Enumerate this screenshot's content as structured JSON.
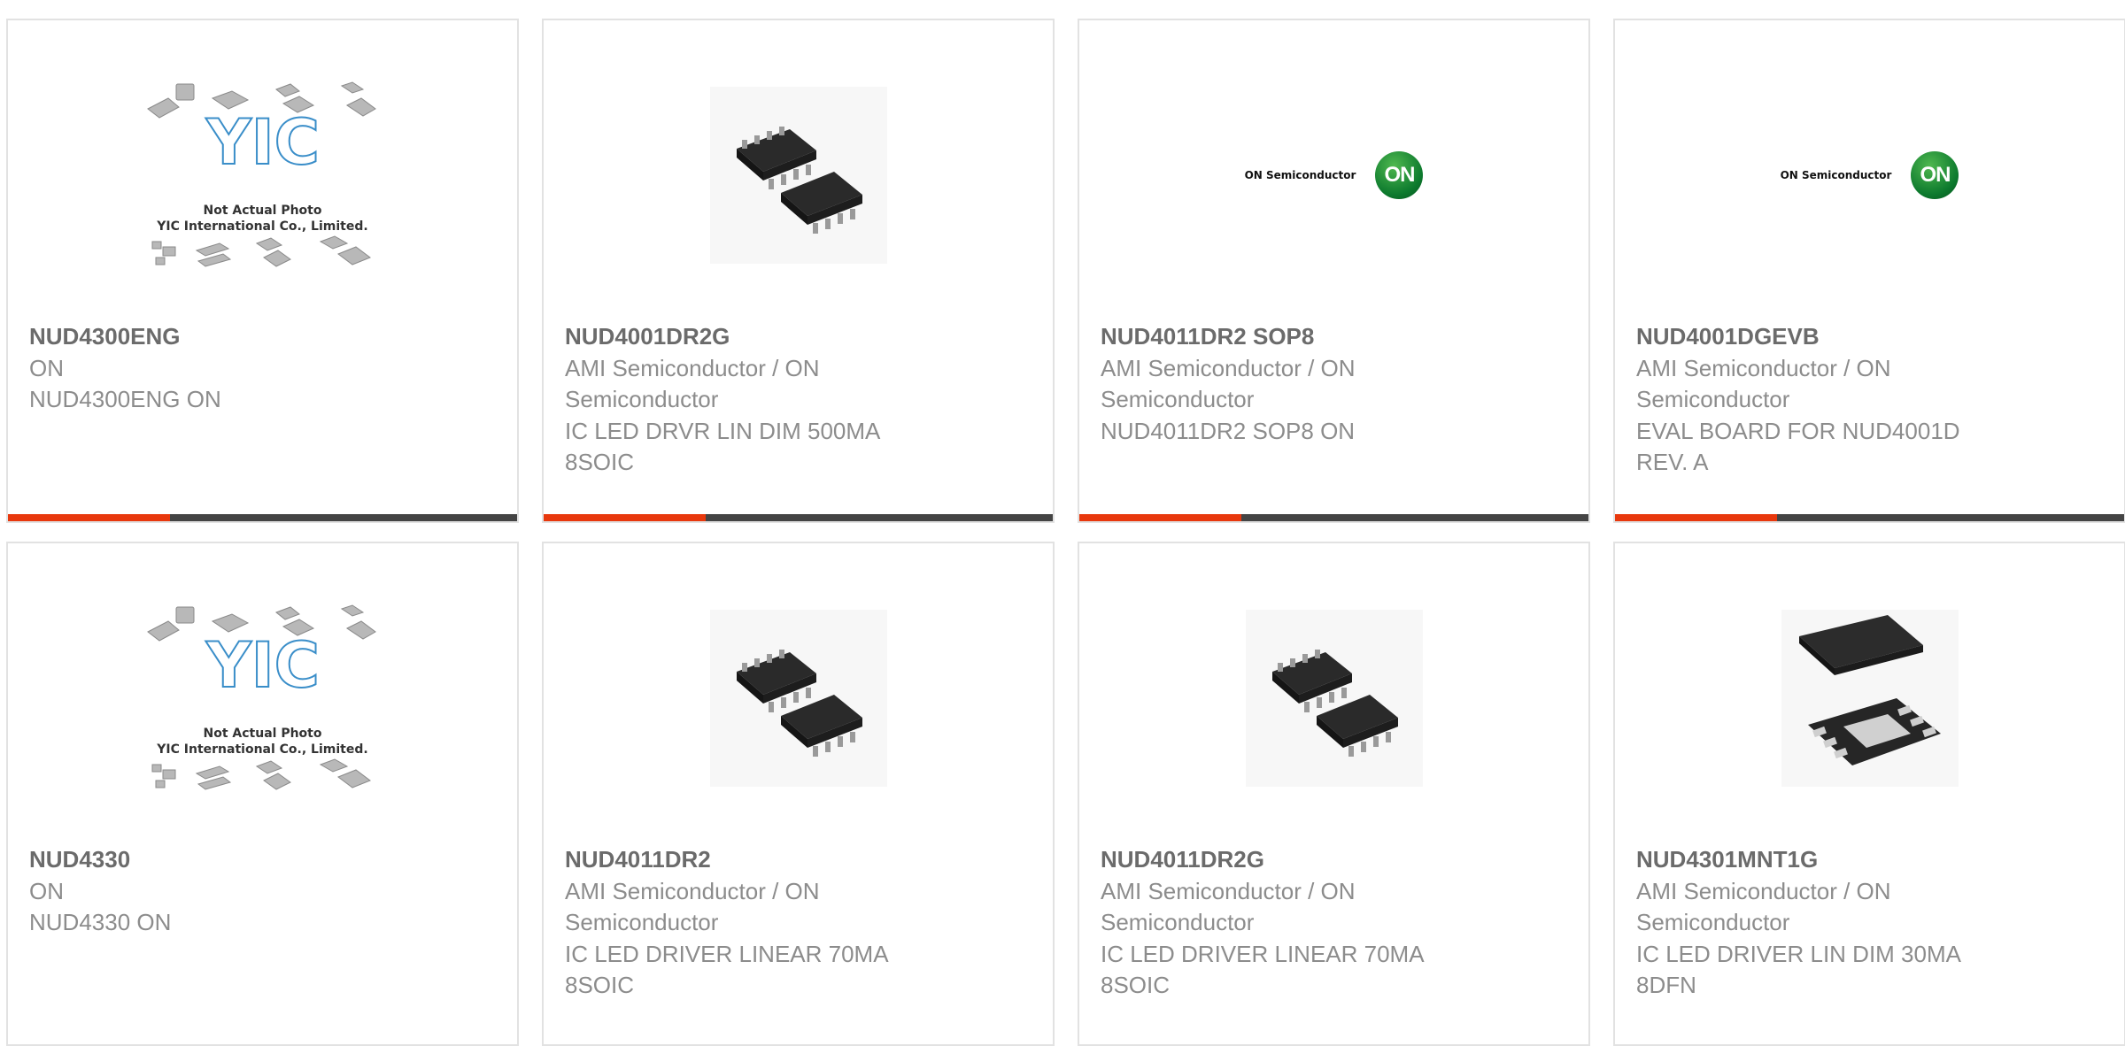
{
  "accent_color": "#e8380d",
  "bar_color": "#444444",
  "placeholder": {
    "line1": "Not Actual Photo",
    "line2": "YIC International Co., Limited."
  },
  "on_logo": {
    "company": "ON Semiconductor",
    "badge": "ON"
  },
  "products": [
    {
      "name": "NUD4300ENG",
      "manufacturer": "ON",
      "description": "NUD4300ENG ON",
      "image": "yic-placeholder"
    },
    {
      "name": "NUD4001DR2G",
      "manufacturer": "AMI Semiconductor / ON Semiconductor",
      "description": "IC LED DRVR LIN DIM 500MA 8SOIC",
      "image": "soic8-package"
    },
    {
      "name": "NUD4011DR2 SOP8",
      "manufacturer": "AMI Semiconductor / ON Semiconductor",
      "description": "NUD4011DR2 SOP8 ON",
      "image": "on-semiconductor-logo"
    },
    {
      "name": "NUD4001DGEVB",
      "manufacturer": "AMI Semiconductor / ON Semiconductor",
      "description": "EVAL BOARD FOR NUD4001D REV. A",
      "image": "on-semiconductor-logo"
    },
    {
      "name": "NUD4330",
      "manufacturer": "ON",
      "description": "NUD4330 ON",
      "image": "yic-placeholder"
    },
    {
      "name": "NUD4011DR2",
      "manufacturer": "AMI Semiconductor / ON Semiconductor",
      "description": "IC LED DRIVER LINEAR 70MA 8SOIC",
      "image": "soic8-package"
    },
    {
      "name": "NUD4011DR2G",
      "manufacturer": "AMI Semiconductor / ON Semiconductor",
      "description": "IC LED DRIVER LINEAR 70MA 8SOIC",
      "image": "soic8-package"
    },
    {
      "name": "NUD4301MNT1G",
      "manufacturer": "AMI Semiconductor / ON Semiconductor",
      "description": "IC LED DRIVER LIN DIM 30MA 8DFN",
      "image": "dfn8-package"
    }
  ]
}
